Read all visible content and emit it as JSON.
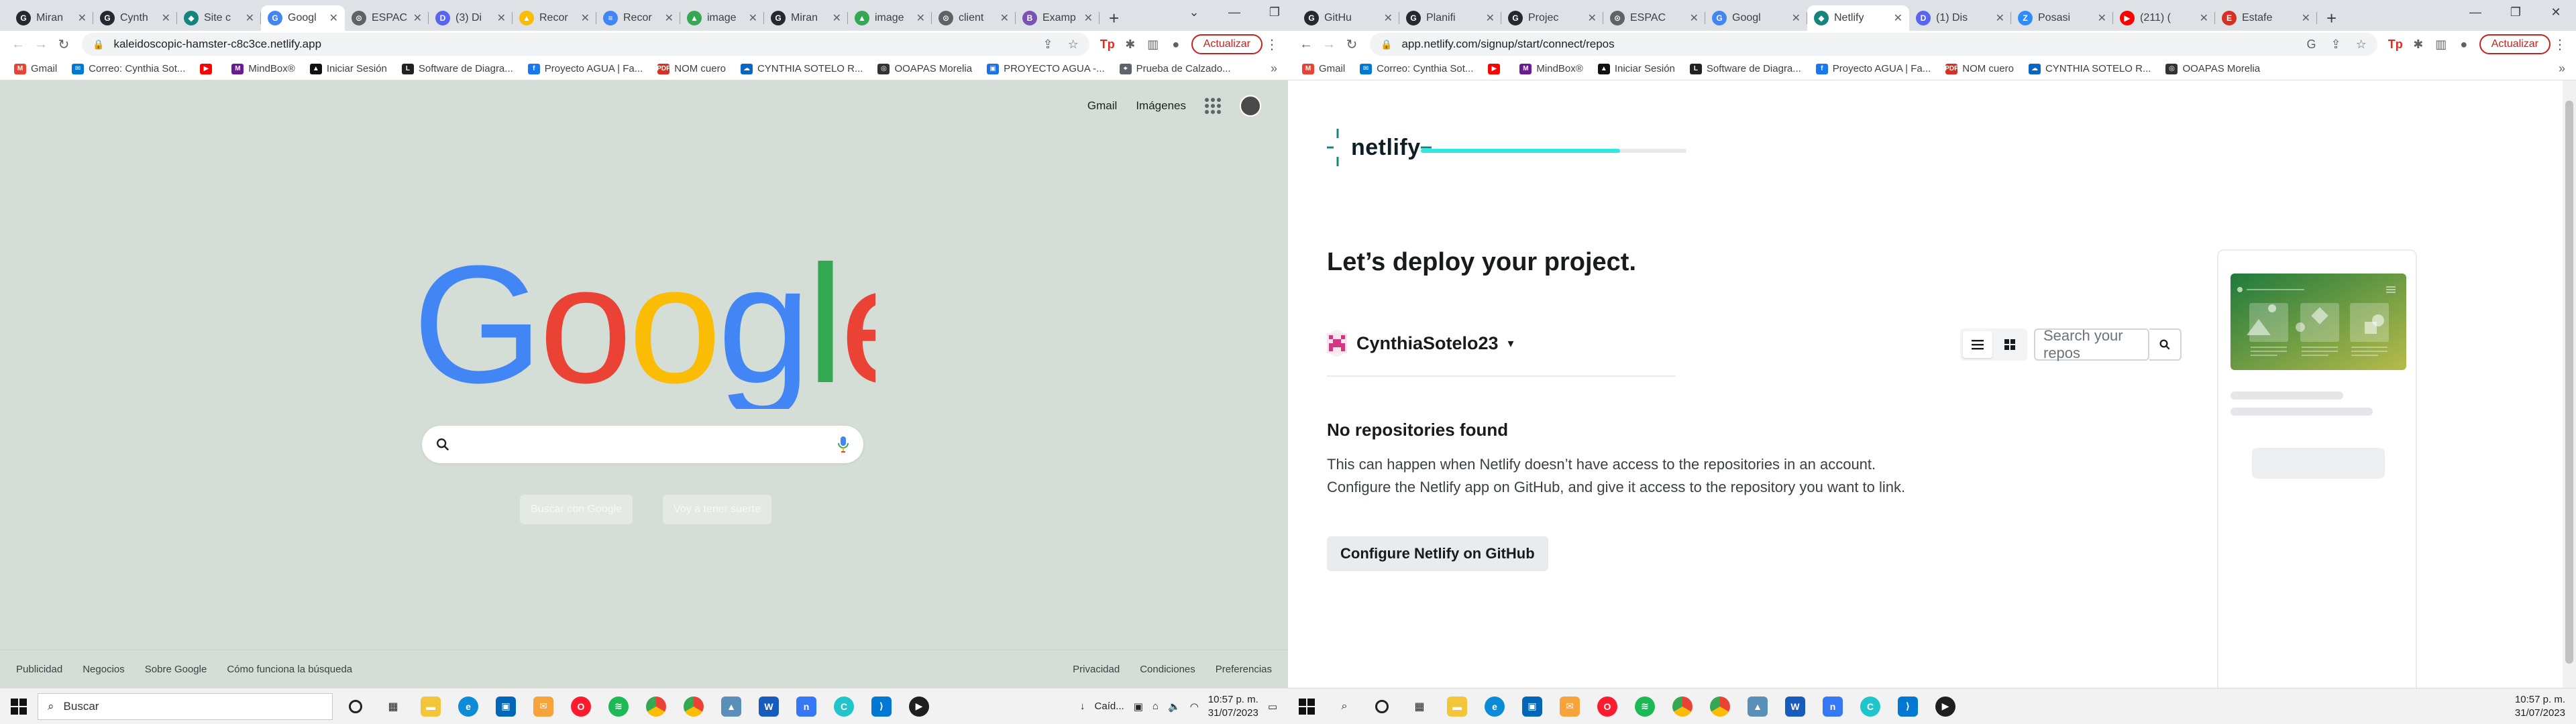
{
  "left": {
    "tabs": [
      {
        "title": "Miran",
        "fav": "#24292f",
        "sym": "G"
      },
      {
        "title": "Cynth",
        "fav": "#24292f",
        "sym": "G"
      },
      {
        "title": "Site c",
        "fav": "#15847d",
        "sym": "◆"
      },
      {
        "title": "Googl",
        "fav": "#4285f4",
        "sym": "G",
        "active": true
      },
      {
        "title": "ESPAC",
        "fav": "#5f6368",
        "sym": "⊙"
      },
      {
        "title": "(3) Di",
        "fav": "#5865f2",
        "sym": "D"
      },
      {
        "title": "Recor",
        "fav": "#fbbc04",
        "sym": "▲"
      },
      {
        "title": "Recor",
        "fav": "#4285f4",
        "sym": "≡"
      },
      {
        "title": "image",
        "fav": "#34a853",
        "sym": "▲"
      },
      {
        "title": "Miran",
        "fav": "#24292f",
        "sym": "G"
      },
      {
        "title": "image",
        "fav": "#34a853",
        "sym": "▲"
      },
      {
        "title": "client",
        "fav": "#5f6368",
        "sym": "⊙"
      },
      {
        "title": "Examp",
        "fav": "#7952b3",
        "sym": "B"
      }
    ],
    "url": "kaleidoscopic-hamster-c8c3ce.netlify.app",
    "update_label": "Actualizar",
    "bookmarks": [
      {
        "label": "Gmail",
        "color": "#ea4335",
        "sym": "M"
      },
      {
        "label": "Correo: Cynthia Sot...",
        "color": "#0078d4",
        "sym": "✉"
      },
      {
        "label": "",
        "color": "#ff0000",
        "sym": "▶"
      },
      {
        "label": "MindBox®",
        "color": "#6a1b9a",
        "sym": "M"
      },
      {
        "label": "Iniciar Sesión",
        "color": "#111111",
        "sym": "▲"
      },
      {
        "label": "Software de Diagra...",
        "color": "#202124",
        "sym": "L"
      },
      {
        "label": "Proyecto AGUA | Fa...",
        "color": "#1877f2",
        "sym": "f"
      },
      {
        "label": "NOM cuero",
        "color": "#d93025",
        "sym": "PDF"
      },
      {
        "label": "CYNTHIA SOTELO R...",
        "color": "#0a66c2",
        "sym": "☁"
      },
      {
        "label": "OOAPAS Morelia",
        "color": "#333333",
        "sym": "◎"
      },
      {
        "label": "PROYECTO AGUA -...",
        "color": "#1a73e8",
        "sym": "▣"
      },
      {
        "label": "Prueba de Calzado...",
        "color": "#5f6368",
        "sym": "⌖"
      }
    ],
    "google": {
      "top_links": [
        "Gmail",
        "Imágenes"
      ],
      "logo_text": "Google",
      "button_search": "Buscar con Google",
      "button_lucky": "Voy a tener suerte",
      "footer_left": [
        "Publicidad",
        "Negocios",
        "Sobre Google",
        "Cómo funciona la búsqueda"
      ],
      "footer_right": [
        "Privacidad",
        "Condiciones",
        "Preferencias"
      ]
    },
    "taskbar": {
      "search_placeholder": "Buscar",
      "weather": "Caíd...",
      "time": "10:57 p. m.",
      "date": "31/07/2023"
    }
  },
  "right": {
    "tabs": [
      {
        "title": "GitHu",
        "fav": "#24292f",
        "sym": "G"
      },
      {
        "title": "Planifi",
        "fav": "#24292f",
        "sym": "G"
      },
      {
        "title": "Projec",
        "fav": "#24292f",
        "sym": "G"
      },
      {
        "title": "ESPAC",
        "fav": "#5f6368",
        "sym": "⊙"
      },
      {
        "title": "Googl",
        "fav": "#4285f4",
        "sym": "G"
      },
      {
        "title": "Netlify",
        "fav": "#15847d",
        "sym": "◆",
        "active": true
      },
      {
        "title": "(1) Dis",
        "fav": "#5865f2",
        "sym": "D"
      },
      {
        "title": "Posasi",
        "fav": "#2d8cff",
        "sym": "Z"
      },
      {
        "title": "(211) (",
        "fav": "#ff0000",
        "sym": "▶"
      },
      {
        "title": "Estafe",
        "fav": "#d93025",
        "sym": "E"
      }
    ],
    "url": "app.netlify.com/signup/start/connect/repos",
    "update_label": "Actualizar",
    "bookmarks": [
      {
        "label": "Gmail",
        "color": "#ea4335",
        "sym": "M"
      },
      {
        "label": "Correo: Cynthia Sot...",
        "color": "#0078d4",
        "sym": "✉"
      },
      {
        "label": "",
        "color": "#ff0000",
        "sym": "▶"
      },
      {
        "label": "MindBox®",
        "color": "#6a1b9a",
        "sym": "M"
      },
      {
        "label": "Iniciar Sesión",
        "color": "#111111",
        "sym": "▲"
      },
      {
        "label": "Software de Diagra...",
        "color": "#202124",
        "sym": "L"
      },
      {
        "label": "Proyecto AGUA | Fa...",
        "color": "#1877f2",
        "sym": "f"
      },
      {
        "label": "NOM cuero",
        "color": "#d93025",
        "sym": "PDF"
      },
      {
        "label": "CYNTHIA SOTELO R...",
        "color": "#0a66c2",
        "sym": "☁"
      },
      {
        "label": "OOAPAS Morelia",
        "color": "#333333",
        "sym": "◎"
      }
    ],
    "netlify": {
      "logo_text": "netlify",
      "progress": 0.75,
      "heading": "Let’s deploy your project.",
      "account": "CynthiaSotelo23",
      "search_placeholder": "Search your repos",
      "empty_title": "No repositories found",
      "empty_line1": "This can happen when Netlify doesn’t have access to the repositories in an account.",
      "empty_line2": "Configure the Netlify app on GitHub, and give it access to the repository you want to link.",
      "configure_button": "Configure Netlify on GitHub"
    },
    "taskbar": {
      "time": "10:57 p. m.",
      "date": "31/07/2023"
    }
  },
  "colors": {
    "google_bg": "#d5ddd7",
    "netlify_teal": "#32e6e2",
    "update_red": "#c5221f"
  }
}
